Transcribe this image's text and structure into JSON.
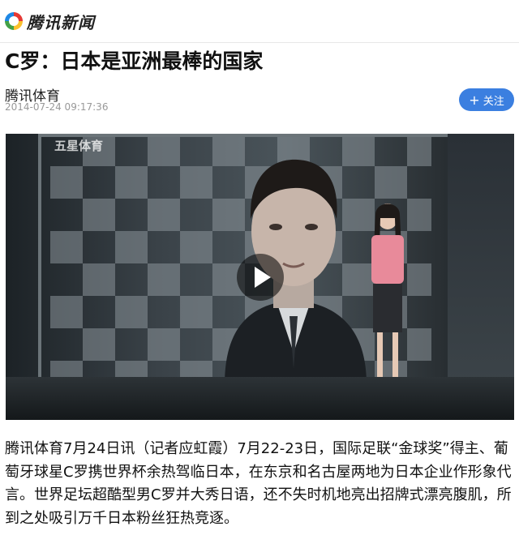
{
  "brand": {
    "logo_text": "腾讯新闻"
  },
  "article": {
    "title": "C罗：日本是亚洲最棒的国家",
    "source": "腾讯体育",
    "datetime": "2014-07-24 09:17:36",
    "follow_label": "关注",
    "follow_icon": "plus-icon",
    "body": "腾讯体育7月24日讯（记者应虹霞）7月22-23日，国际足联“金球奖”得主、葡萄牙球星C罗携世界杯余热驾临日本，在东京和名古屋两地为日本企业作形象代言。世界足坛超酷型男C罗并大秀日语，还不失时机地亮出招牌式漂亮腹肌，所到之处吸引万千日本粉丝狂热竞逐。"
  },
  "video": {
    "watermark": "五星体育",
    "play_icon": "play-icon"
  },
  "colors": {
    "accent": "#3b7fe0"
  }
}
